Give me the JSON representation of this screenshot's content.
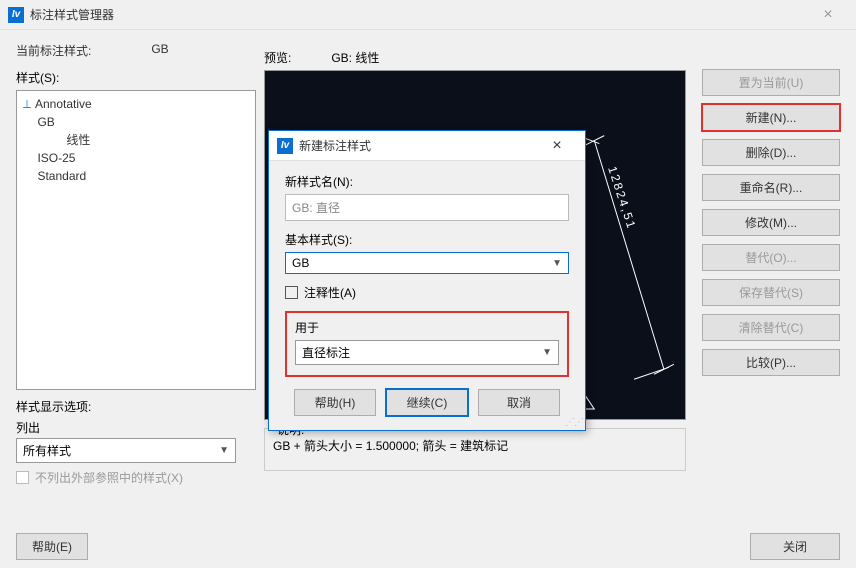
{
  "window": {
    "title": "标注样式管理器",
    "icon_letter": "Iv"
  },
  "current_style_label": "当前标注样式:",
  "current_style_value": "GB",
  "styles_label": "样式(S):",
  "styles_tree": {
    "annotative": "Annotative",
    "gb": "GB",
    "gb_linear": "线性",
    "iso25": "ISO-25",
    "standard": "Standard"
  },
  "preview_label": "预览:",
  "preview_name": "GB: 线性",
  "preview_dim_value": "12824,51",
  "right_buttons": {
    "set_current": "置为当前(U)",
    "new": "新建(N)...",
    "delete": "删除(D)...",
    "rename": "重命名(R)...",
    "modify": "修改(M)...",
    "override": "替代(O)...",
    "save_override": "保存替代(S)",
    "clear_override": "清除替代(C)",
    "compare": "比较(P)..."
  },
  "display_opts_label": "样式显示选项:",
  "list_label": "列出",
  "list_value": "所有样式",
  "xref_checkbox_label": "不列出外部参照中的样式(X)",
  "description_label": "说明:",
  "description_text": "GB + 箭头大小  = 1.500000; 箭头 = 建筑标记",
  "footer": {
    "help": "帮助(E)",
    "close": "关闭"
  },
  "modal": {
    "title": "新建标注样式",
    "new_name_label": "新样式名(N):",
    "new_name_value": "GB: 直径",
    "base_style_label": "基本样式(S):",
    "base_style_value": "GB",
    "annotative_label": "注释性(A)",
    "used_for_label": "用于",
    "used_for_value": "直径标注",
    "help": "帮助(H)",
    "continue": "继续(C)",
    "cancel": "取消"
  }
}
